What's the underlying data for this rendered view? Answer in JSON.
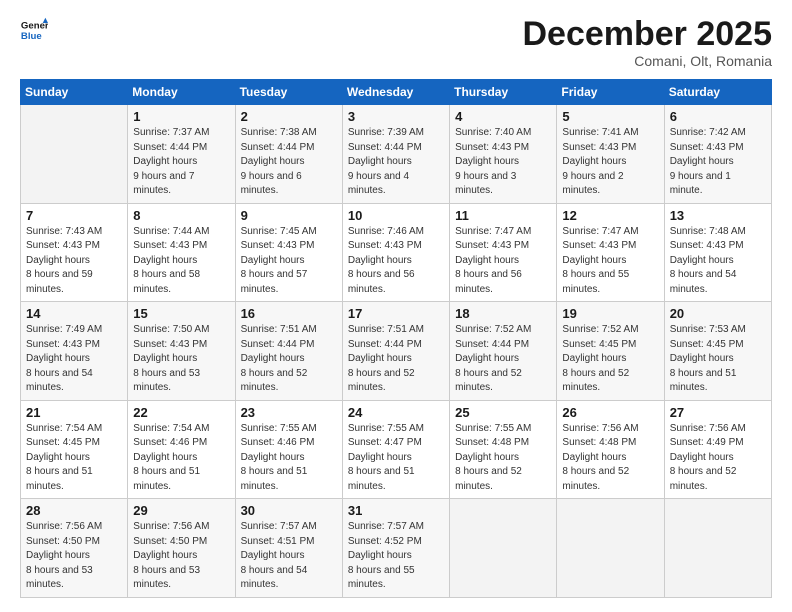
{
  "header": {
    "logo_line1": "General",
    "logo_line2": "Blue",
    "month": "December 2025",
    "location": "Comani, Olt, Romania"
  },
  "weekdays": [
    "Sunday",
    "Monday",
    "Tuesday",
    "Wednesday",
    "Thursday",
    "Friday",
    "Saturday"
  ],
  "weeks": [
    [
      {
        "day": "",
        "empty": true
      },
      {
        "day": "1",
        "sunrise": "7:37 AM",
        "sunset": "4:44 PM",
        "daylight": "9 hours and 7 minutes."
      },
      {
        "day": "2",
        "sunrise": "7:38 AM",
        "sunset": "4:44 PM",
        "daylight": "9 hours and 6 minutes."
      },
      {
        "day": "3",
        "sunrise": "7:39 AM",
        "sunset": "4:44 PM",
        "daylight": "9 hours and 4 minutes."
      },
      {
        "day": "4",
        "sunrise": "7:40 AM",
        "sunset": "4:43 PM",
        "daylight": "9 hours and 3 minutes."
      },
      {
        "day": "5",
        "sunrise": "7:41 AM",
        "sunset": "4:43 PM",
        "daylight": "9 hours and 2 minutes."
      },
      {
        "day": "6",
        "sunrise": "7:42 AM",
        "sunset": "4:43 PM",
        "daylight": "9 hours and 1 minute."
      }
    ],
    [
      {
        "day": "7",
        "sunrise": "7:43 AM",
        "sunset": "4:43 PM",
        "daylight": "8 hours and 59 minutes."
      },
      {
        "day": "8",
        "sunrise": "7:44 AM",
        "sunset": "4:43 PM",
        "daylight": "8 hours and 58 minutes."
      },
      {
        "day": "9",
        "sunrise": "7:45 AM",
        "sunset": "4:43 PM",
        "daylight": "8 hours and 57 minutes."
      },
      {
        "day": "10",
        "sunrise": "7:46 AM",
        "sunset": "4:43 PM",
        "daylight": "8 hours and 56 minutes."
      },
      {
        "day": "11",
        "sunrise": "7:47 AM",
        "sunset": "4:43 PM",
        "daylight": "8 hours and 56 minutes."
      },
      {
        "day": "12",
        "sunrise": "7:47 AM",
        "sunset": "4:43 PM",
        "daylight": "8 hours and 55 minutes."
      },
      {
        "day": "13",
        "sunrise": "7:48 AM",
        "sunset": "4:43 PM",
        "daylight": "8 hours and 54 minutes."
      }
    ],
    [
      {
        "day": "14",
        "sunrise": "7:49 AM",
        "sunset": "4:43 PM",
        "daylight": "8 hours and 54 minutes."
      },
      {
        "day": "15",
        "sunrise": "7:50 AM",
        "sunset": "4:43 PM",
        "daylight": "8 hours and 53 minutes."
      },
      {
        "day": "16",
        "sunrise": "7:51 AM",
        "sunset": "4:44 PM",
        "daylight": "8 hours and 52 minutes."
      },
      {
        "day": "17",
        "sunrise": "7:51 AM",
        "sunset": "4:44 PM",
        "daylight": "8 hours and 52 minutes."
      },
      {
        "day": "18",
        "sunrise": "7:52 AM",
        "sunset": "4:44 PM",
        "daylight": "8 hours and 52 minutes."
      },
      {
        "day": "19",
        "sunrise": "7:52 AM",
        "sunset": "4:45 PM",
        "daylight": "8 hours and 52 minutes."
      },
      {
        "day": "20",
        "sunrise": "7:53 AM",
        "sunset": "4:45 PM",
        "daylight": "8 hours and 51 minutes."
      }
    ],
    [
      {
        "day": "21",
        "sunrise": "7:54 AM",
        "sunset": "4:45 PM",
        "daylight": "8 hours and 51 minutes."
      },
      {
        "day": "22",
        "sunrise": "7:54 AM",
        "sunset": "4:46 PM",
        "daylight": "8 hours and 51 minutes."
      },
      {
        "day": "23",
        "sunrise": "7:55 AM",
        "sunset": "4:46 PM",
        "daylight": "8 hours and 51 minutes."
      },
      {
        "day": "24",
        "sunrise": "7:55 AM",
        "sunset": "4:47 PM",
        "daylight": "8 hours and 51 minutes."
      },
      {
        "day": "25",
        "sunrise": "7:55 AM",
        "sunset": "4:48 PM",
        "daylight": "8 hours and 52 minutes."
      },
      {
        "day": "26",
        "sunrise": "7:56 AM",
        "sunset": "4:48 PM",
        "daylight": "8 hours and 52 minutes."
      },
      {
        "day": "27",
        "sunrise": "7:56 AM",
        "sunset": "4:49 PM",
        "daylight": "8 hours and 52 minutes."
      }
    ],
    [
      {
        "day": "28",
        "sunrise": "7:56 AM",
        "sunset": "4:50 PM",
        "daylight": "8 hours and 53 minutes."
      },
      {
        "day": "29",
        "sunrise": "7:56 AM",
        "sunset": "4:50 PM",
        "daylight": "8 hours and 53 minutes."
      },
      {
        "day": "30",
        "sunrise": "7:57 AM",
        "sunset": "4:51 PM",
        "daylight": "8 hours and 54 minutes."
      },
      {
        "day": "31",
        "sunrise": "7:57 AM",
        "sunset": "4:52 PM",
        "daylight": "8 hours and 55 minutes."
      },
      {
        "day": "",
        "empty": true
      },
      {
        "day": "",
        "empty": true
      },
      {
        "day": "",
        "empty": true
      }
    ]
  ]
}
